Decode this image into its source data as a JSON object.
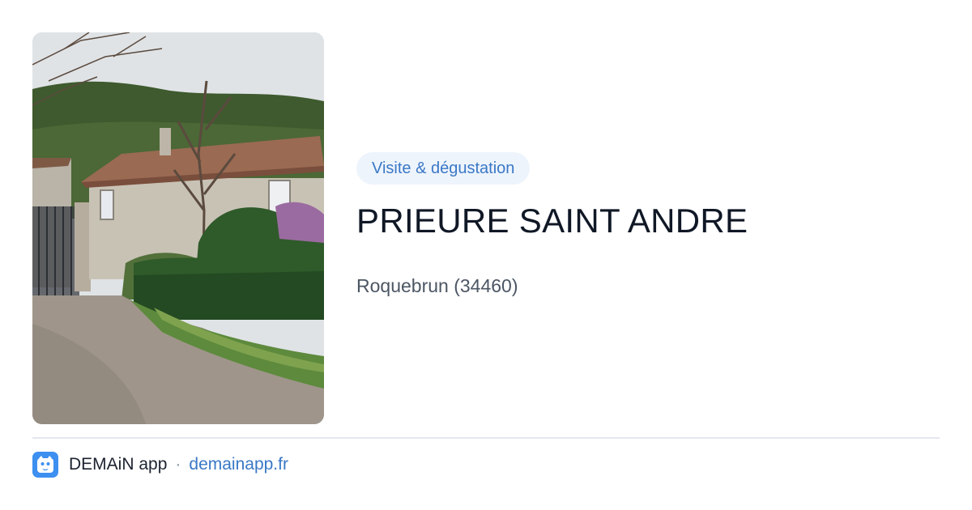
{
  "listing": {
    "category": "Visite & dégustation",
    "title": "PRIEURE SAINT ANDRE",
    "location": "Roquebrun (34460)"
  },
  "footer": {
    "app_name": "DEMAiN app",
    "separator": "·",
    "url": "demainapp.fr"
  },
  "icons": {
    "app_logo": "paw-shield-icon"
  },
  "colors": {
    "accent": "#3a78c6",
    "tag_background": "#eef4fc",
    "title": "#101826",
    "muted": "#4c5664",
    "logo": "#3d8ff0"
  }
}
